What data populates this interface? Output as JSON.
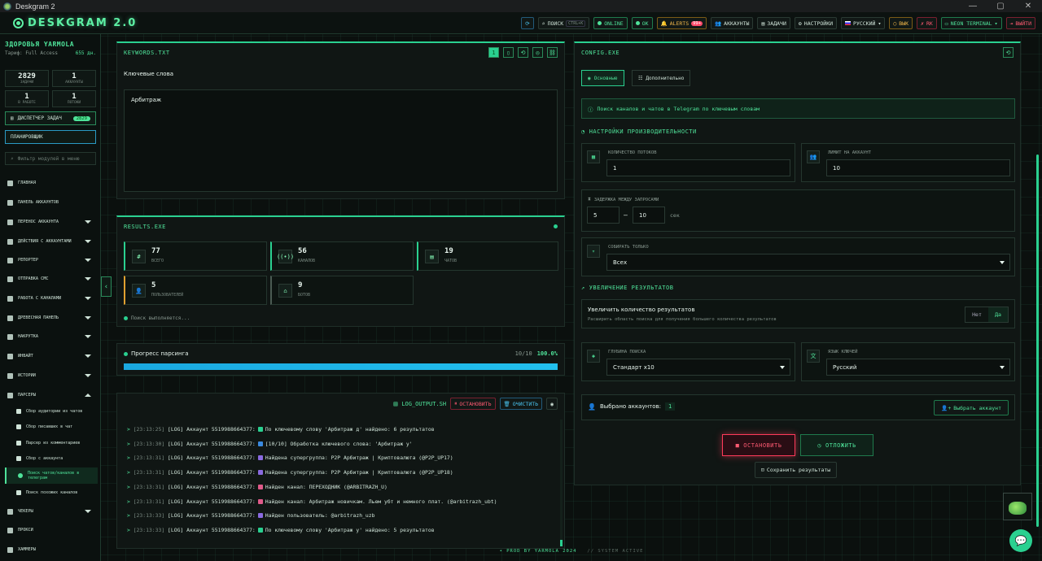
{
  "window": {
    "title": "Deskgram 2",
    "min": "—",
    "max": "▢",
    "close": "✕"
  },
  "header": {
    "logo": "DESKGRAM 2.0",
    "refresh": "⟳",
    "search": "ПОИСК",
    "search_kbd": "CTRL+K",
    "online": "ONLINE",
    "ok": "OK",
    "alerts": "ALERTS",
    "alerts_count": "99+",
    "accounts": "АККАУНТЫ",
    "tasks": "ЗАДАЧИ",
    "settings": "НАСТРОЙКИ",
    "language": "РУССКИЙ",
    "off": "ВЫК",
    "rk": "RK",
    "theme": "NEON TERMINAL",
    "logout": "ВЫЙТИ"
  },
  "sidebar": {
    "user": "ЗДОРОВЬЯ YARMOLA",
    "tariff_label": "Тариф: Full Access",
    "tariff_days": "655 дн.",
    "stats": [
      {
        "n": "2829",
        "l": "задачи"
      },
      {
        "n": "1",
        "l": "аккаунты"
      },
      {
        "n": "1",
        "l": "в работе"
      },
      {
        "n": "1",
        "l": "потоки"
      }
    ],
    "dispatcher": "ДИСПЕТЧЕР ЗАДАЧ",
    "dispatcher_count": "2829",
    "scheduler": "ПЛАНИРОВЩИК",
    "filter_placeholder": "Фильтр модулей в меню",
    "nav": [
      {
        "label": "главная"
      },
      {
        "label": "панель аккаунтов"
      },
      {
        "label": "перенос аккаунта"
      },
      {
        "label": "действия с аккаунтами"
      },
      {
        "label": "репортер"
      },
      {
        "label": "отправка смс"
      },
      {
        "label": "работа с каналами"
      },
      {
        "label": "древесная панель"
      },
      {
        "label": "накрутка"
      },
      {
        "label": "инвайт"
      },
      {
        "label": "истории"
      },
      {
        "label": "парсеры"
      }
    ],
    "sub": [
      "Сбор аудитории из чатов",
      "Сбор писавших в чат",
      "Парсер из комментариев",
      "Сбор с аккаунта",
      "Поиск чатов/каналов в телеграм",
      "Поиск похожих каналов"
    ],
    "nav_bottom": [
      {
        "label": "чекеры"
      },
      {
        "label": "прокси"
      },
      {
        "label": "хаммеры"
      }
    ]
  },
  "keywords": {
    "title": "KEYWORDS.TXT",
    "label": "Ключевые слова",
    "value": "Арбитраж"
  },
  "results": {
    "title": "RESULTS.EXE",
    "cards": [
      {
        "n": "77",
        "l": "всего",
        "icon": "#"
      },
      {
        "n": "56",
        "l": "каналов",
        "icon": "((•))"
      },
      {
        "n": "19",
        "l": "чатов",
        "icon": "▤"
      },
      {
        "n": "5",
        "l": "пользователей",
        "icon": "👤"
      },
      {
        "n": "9",
        "l": "ботов",
        "icon": "⌂"
      }
    ],
    "status": "Поиск выполняется..."
  },
  "progress": {
    "label": "Прогресс парсинга",
    "count": "10/10",
    "percent": "100.0%",
    "value": 1.0
  },
  "log": {
    "title": "LOG_OUTPUT.SH",
    "stop": "ОСТАНОВИТЬ",
    "clear": "ОЧИСТИТЬ",
    "lines": [
      {
        "t": "[23:13:25]",
        "m": "[LOG] Аккаунт 5519988664377:",
        "e": "#2ad090",
        "x": "По ключевому слову 'Арбитраж д' найдено: 6 результатов"
      },
      {
        "t": "[23:13:30]",
        "m": "[LOG] Аккаунт 5519988664377:",
        "e": "#3a8ae0",
        "x": "[10/10] Обработка ключевого слова: 'Арбитраж у'"
      },
      {
        "t": "[23:13:31]",
        "m": "[LOG] Аккаунт 5519988664377:",
        "e": "#8a6ae0",
        "x": "Найдена супергруппа: P2P Арбитраж | Криптовалюта (@P2P_UP17)"
      },
      {
        "t": "[23:13:31]",
        "m": "[LOG] Аккаунт 5519988664377:",
        "e": "#8a6ae0",
        "x": "Найдена супергруппа: P2P Арбитраж | Криптовалюта (@P2P_UP18)"
      },
      {
        "t": "[23:13:31]",
        "m": "[LOG] Аккаунт 5519988664377:",
        "e": "#e05a8a",
        "x": "Найден канал: ПЕРЕХОДНИК (@ARBITRAZH_U)"
      },
      {
        "t": "[23:13:31]",
        "m": "[LOG] Аккаунт 5519988664377:",
        "e": "#e05a8a",
        "x": "Найден канал: Арбитраж новичкам. Льем убт и немного плат. (@arbitrazh_ubt)"
      },
      {
        "t": "[23:13:33]",
        "m": "[LOG] Аккаунт 5519988664377:",
        "e": "#8a6ae0",
        "x": "Найден пользователь: @arbitrazh_uzb"
      },
      {
        "t": "[23:13:33]",
        "m": "[LOG] Аккаунт 5519988664377:",
        "e": "#2ad090",
        "x": "По ключевому слову 'Арбитраж у' найдено: 5 результатов"
      }
    ]
  },
  "config": {
    "title": "CONFIG.EXE",
    "tab_main": "Основные",
    "tab_extra": "Дополнительно",
    "info": "Поиск каналов и чатов в Telegram по ключевым словам",
    "perf_title": "НАСТРОЙКИ ПРОИЗВОДИТЕЛЬНОСТИ",
    "threads_label": "Количество потоков",
    "threads": "1",
    "limit_label": "Лимит на аккаунт",
    "limit": "10",
    "delay_label": "Задержка между запросами",
    "delay_from": "5",
    "delay_dash": "—",
    "delay_to": "10",
    "delay_unit": "сек",
    "collect_label": "Собирать только",
    "collect": "Всех",
    "boost_title": "УВЕЛИЧЕНИЕ РЕЗУЛЬТАТОВ",
    "boost_label": "Увеличить количество результатов",
    "boost_desc": "Расширить область поиска для получения большего количества результатов",
    "no": "Нет",
    "yes": "Да",
    "depth_label": "Глубина поиска",
    "depth": "Стандарт x10",
    "lang_label": "Язык ключей",
    "lang": "Русский",
    "selected_label": "Выбрано аккаунтов:",
    "selected": "1",
    "choose": "Выбрать аккаунт",
    "stop": "ОСТАНОВИТЬ",
    "start": "ОТЛОЖИТЬ",
    "save": "Сохранить результаты"
  },
  "footer": {
    "left": "• PROD BY YARMOLA 2024",
    "right": "// SYSTEM ACTIVE"
  }
}
